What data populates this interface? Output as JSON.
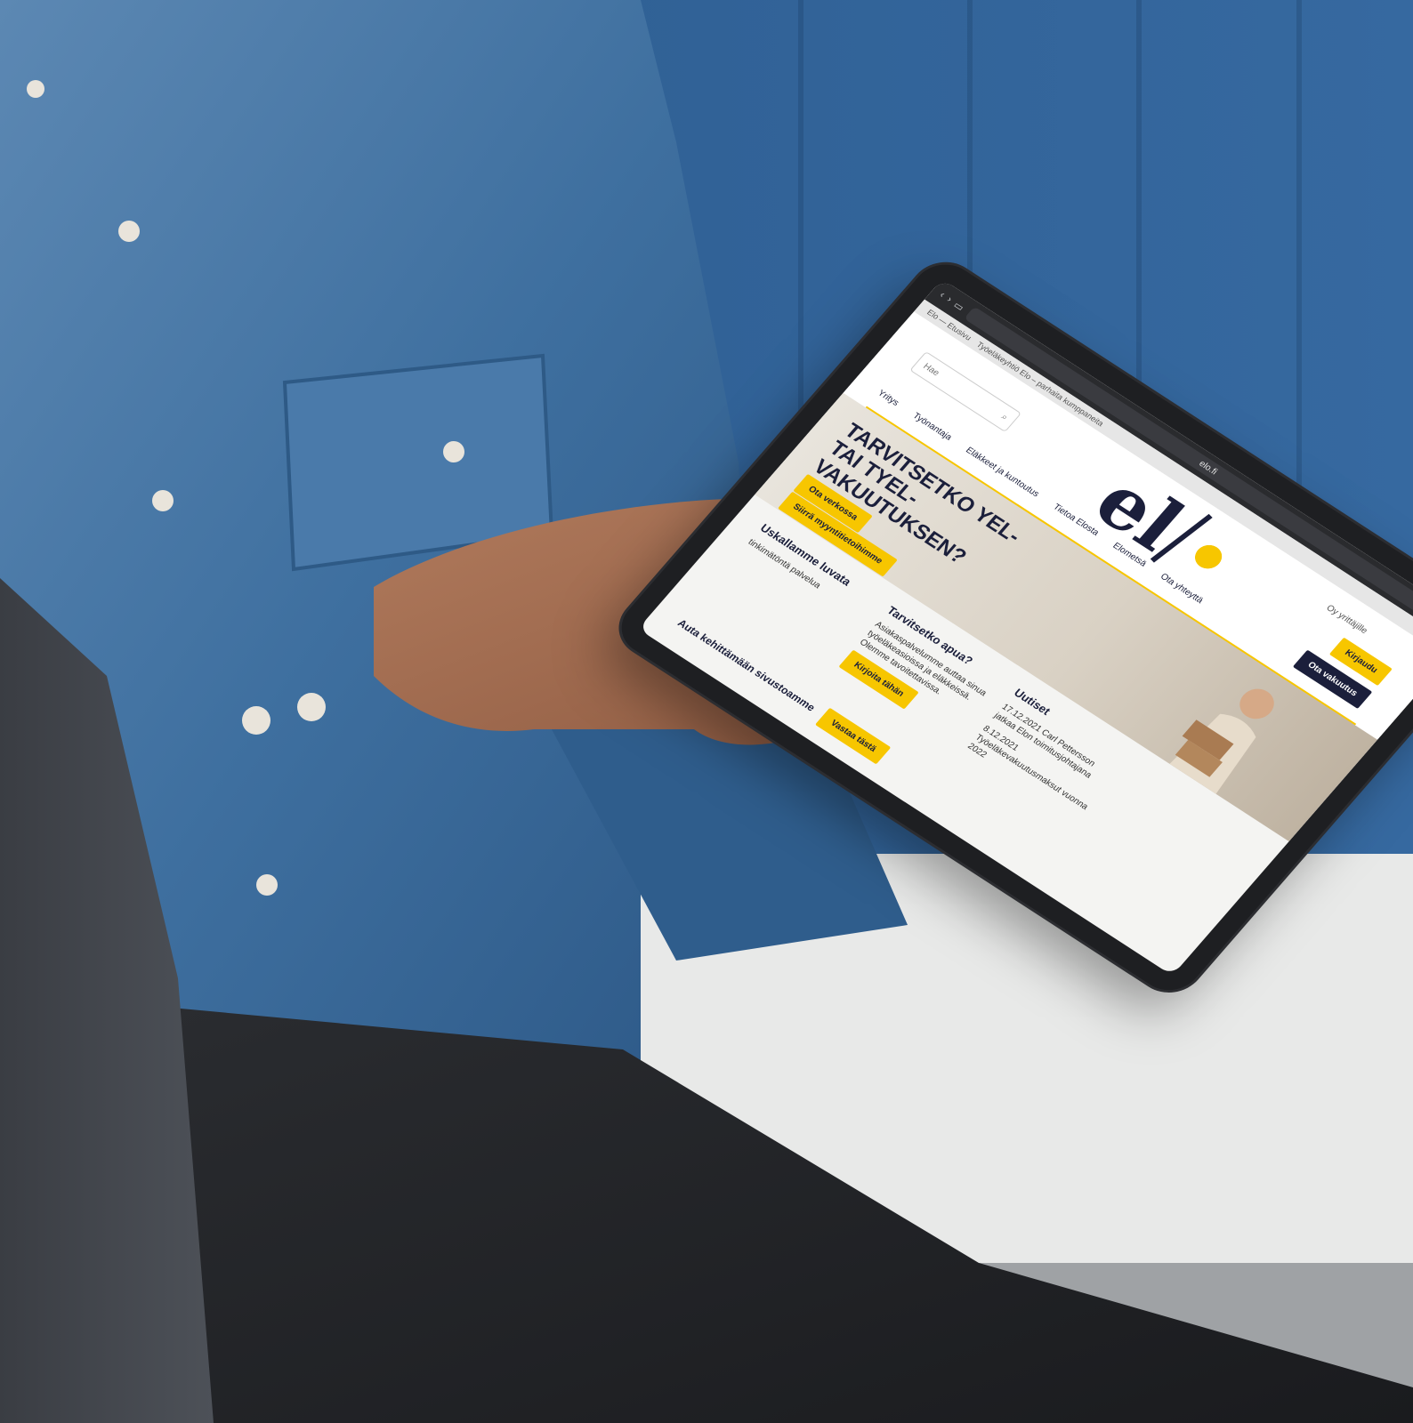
{
  "browser": {
    "url": "elo.fi",
    "tab_left": "Elo — Etusivu",
    "tab_right": "Työeläkeyhtiö Elo – parhaita kumppaneita"
  },
  "site": {
    "search_placeholder": "Hae",
    "logo_text": "el",
    "login_link": "Oy yrittäjille",
    "btn_kirjaudu": "Kirjaudu",
    "btn_ota_vakuutus": "Ota vakuutus",
    "menu": [
      "Yritys",
      "Työnantaja",
      "Eläkkeet ja kuntoutus",
      "Tietoa Elosta",
      "Elometsä",
      "Ota yhteyttä"
    ]
  },
  "hero": {
    "title": "TARVITSETKO YEL- TAI TYEL-VAKUUTUKSEN?",
    "btn_primary": "Ota verkossa",
    "btn_secondary": "Siirrä myyntitietoihimme"
  },
  "content": {
    "col1_title": "Uskallamme luvata",
    "col1_subtitle": "tinkimätöntä palvelua",
    "col2_title": "Tarvitsetko apua?",
    "col2_text": "Asiakaspalvelumme auttaa sinua työeläkeasioissa ja eläkkeissä. Olemme tavoitettavissa.",
    "col3_title": "Uutiset",
    "news": [
      {
        "date": "17.12.2021",
        "text": "Carl Pettersson jatkaa Elon toimitusjohtajana"
      },
      {
        "date": "8.12.2021",
        "text": "Työeläkevakuutusmaksut vuonna 2022"
      }
    ],
    "banner": "Auta kehittämään sivustoamme",
    "banner_btn": "Vastaa tästä",
    "help_btn": "Kirjoita tähän"
  },
  "colors": {
    "brand_yellow": "#f7c600",
    "brand_navy": "#1b1f3b",
    "wall_blue": "#2f5f92",
    "denim": "#3d6f9f"
  }
}
